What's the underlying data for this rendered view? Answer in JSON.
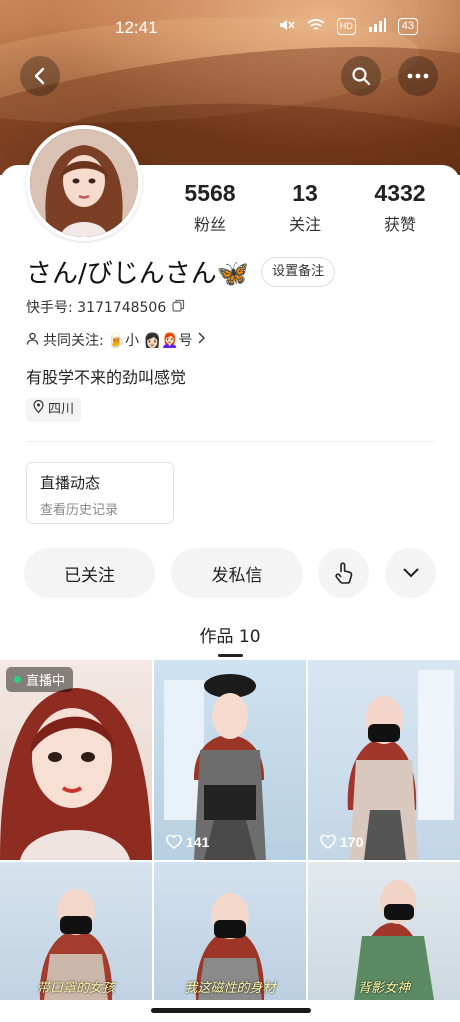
{
  "status_bar": {
    "time": "12:41",
    "battery": "43",
    "hd_label": "HD"
  },
  "colors": {
    "accent_green": "#29d37d",
    "banner_brown": "#b46c40"
  },
  "header_icons": [
    "back-icon",
    "search-icon",
    "more-icon"
  ],
  "profile": {
    "stats": [
      {
        "value": "5568",
        "label": "粉丝"
      },
      {
        "value": "13",
        "label": "关注"
      },
      {
        "value": "4332",
        "label": "获赞"
      }
    ],
    "name": "さん/びじんさん🦋",
    "remark_button": "设置备注",
    "kuaishou_id": "快手号: 3171748506",
    "mutual_label": "共同关注:",
    "mutual_names": "🍺小 👩🏻👩🏻‍🦰号",
    "bio": "有股学不来的劲叫感觉",
    "location": "四川"
  },
  "live_card": {
    "title": "直播动态",
    "subtitle": "查看历史记录"
  },
  "actions": {
    "follow": "已关注",
    "message": "发私信"
  },
  "tab": {
    "label": "作品 10"
  },
  "works": [
    {
      "badge": "直播中",
      "likes": "",
      "caption": ""
    },
    {
      "badge": "",
      "likes": "141",
      "caption": ""
    },
    {
      "badge": "",
      "likes": "170",
      "caption": ""
    },
    {
      "badge": "",
      "likes": "",
      "caption": "带口罩的女孩"
    },
    {
      "badge": "",
      "likes": "",
      "caption": "我这磁性的身材"
    },
    {
      "badge": "",
      "likes": "",
      "caption": "背影女神"
    }
  ]
}
